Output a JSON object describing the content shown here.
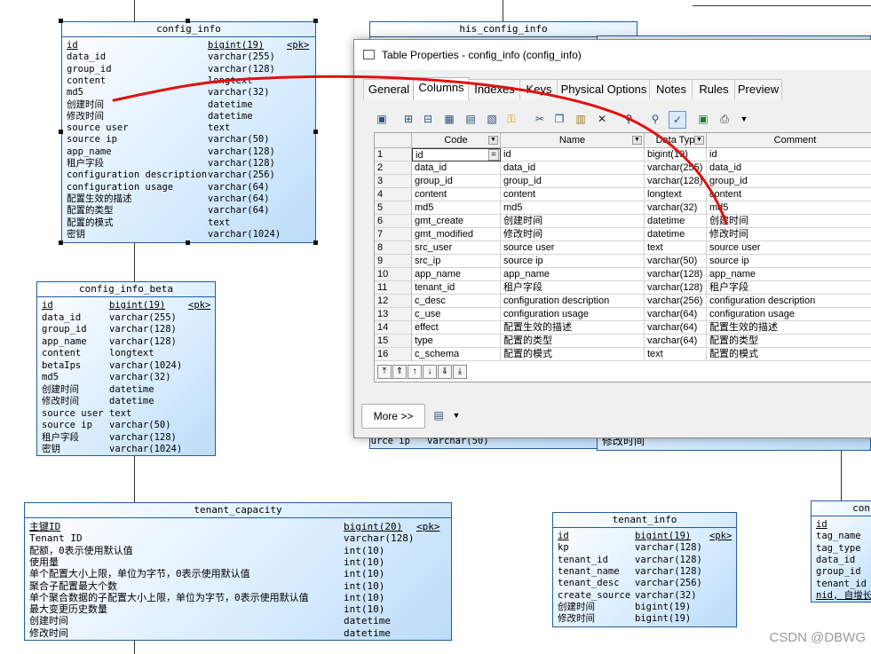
{
  "tables": {
    "config_info": {
      "title": "config_info",
      "pk": "<pk>",
      "rows": [
        [
          "id",
          "bigint(19)"
        ],
        [
          "data_id",
          "varchar(255)"
        ],
        [
          "group_id",
          "varchar(128)"
        ],
        [
          "content",
          "longtext"
        ],
        [
          "md5",
          "varchar(32)"
        ],
        [
          "创建时间",
          "datetime"
        ],
        [
          "修改时间",
          "datetime"
        ],
        [
          "source user",
          "text"
        ],
        [
          "source ip",
          "varchar(50)"
        ],
        [
          "app_name",
          "varchar(128)"
        ],
        [
          "租户字段",
          "varchar(128)"
        ],
        [
          "configuration description",
          "varchar(256)"
        ],
        [
          "configuration usage",
          "varchar(64)"
        ],
        [
          "配置生效的描述",
          "varchar(64)"
        ],
        [
          "配置的类型",
          "varchar(64)"
        ],
        [
          "配置的模式",
          "text"
        ],
        [
          "密钥",
          "varchar(1024)"
        ]
      ]
    },
    "his_config_info": {
      "title": "his_config_info",
      "bottom_row": [
        "source ip",
        "varchar(50)"
      ]
    },
    "right_partial": {
      "title": "",
      "bottom_row": "修改时间"
    },
    "config_info_beta": {
      "title": "config_info_beta",
      "pk": "<pk>",
      "rows": [
        [
          "id",
          "bigint(19)"
        ],
        [
          "data_id",
          "varchar(255)"
        ],
        [
          "group_id",
          "varchar(128)"
        ],
        [
          "app_name",
          "varchar(128)"
        ],
        [
          "content",
          "longtext"
        ],
        [
          "betaIps",
          "varchar(1024)"
        ],
        [
          "md5",
          "varchar(32)"
        ],
        [
          "创建时间",
          "datetime"
        ],
        [
          "修改时间",
          "datetime"
        ],
        [
          "source user",
          "text"
        ],
        [
          "source ip",
          "varchar(50)"
        ],
        [
          "租户字段",
          "varchar(128)"
        ],
        [
          "密钥",
          "varchar(1024)"
        ]
      ]
    },
    "tenant_capacity": {
      "title": "tenant_capacity",
      "pk": "<pk>",
      "rows": [
        [
          "主键ID",
          "bigint(20)"
        ],
        [
          "Tenant ID",
          "varchar(128)"
        ],
        [
          "配额，0表示使用默认值",
          "int(10)"
        ],
        [
          "使用量",
          "int(10)"
        ],
        [
          "单个配置大小上限，单位为字节，0表示使用默认值",
          "int(10)"
        ],
        [
          "聚合子配置最大个数",
          "int(10)"
        ],
        [
          "单个聚合数据的子配置大小上限，单位为字节，0表示使用默认值",
          "int(10)"
        ],
        [
          "最大变更历史数量",
          "int(10)"
        ],
        [
          "创建时间",
          "datetime"
        ],
        [
          "修改时间",
          "datetime"
        ]
      ]
    },
    "tenant_info": {
      "title": "tenant_info",
      "pk": "<pk>",
      "rows": [
        [
          "id",
          "bigint(19)"
        ],
        [
          "kp",
          "varchar(128)"
        ],
        [
          "tenant_id",
          "varchar(128)"
        ],
        [
          "tenant_name",
          "varchar(128)"
        ],
        [
          "tenant_desc",
          "varchar(256)"
        ],
        [
          "create_source",
          "varchar(32)"
        ],
        [
          "创建时间",
          "bigint(19)"
        ],
        [
          "修改时间",
          "bigint(19)"
        ]
      ]
    },
    "partial_right": {
      "title": "con",
      "rows": [
        "id",
        "tag_name",
        "tag_type",
        "data_id",
        "group_id",
        "tenant_id",
        "nid, 自增长"
      ]
    }
  },
  "dialog": {
    "title": "Table Properties - config_info (config_info)",
    "tabs": [
      "General",
      "Columns",
      "Indexes",
      "Keys",
      "Physical Options",
      "Notes",
      "Rules",
      "Preview"
    ],
    "active_tab": "Columns",
    "columns": [
      "Code",
      "Name",
      "Data Typ",
      "Comment"
    ],
    "rows": [
      [
        "1",
        "id",
        "id",
        "bigint(19)",
        "id"
      ],
      [
        "2",
        "data_id",
        "data_id",
        "varchar(255)",
        "data_id"
      ],
      [
        "3",
        "group_id",
        "group_id",
        "varchar(128)",
        "group_id"
      ],
      [
        "4",
        "content",
        "content",
        "longtext",
        "content"
      ],
      [
        "5",
        "md5",
        "md5",
        "varchar(32)",
        "md5"
      ],
      [
        "6",
        "gmt_create",
        "创建时间",
        "datetime",
        "创建时间"
      ],
      [
        "7",
        "gmt_modified",
        "修改时间",
        "datetime",
        "修改时间"
      ],
      [
        "8",
        "src_user",
        "source user",
        "text",
        "source user"
      ],
      [
        "9",
        "src_ip",
        "source ip",
        "varchar(50)",
        "source ip"
      ],
      [
        "10",
        "app_name",
        "app_name",
        "varchar(128)",
        "app_name"
      ],
      [
        "11",
        "tenant_id",
        "租户字段",
        "varchar(128)",
        "租户字段"
      ],
      [
        "12",
        "c_desc",
        "configuration description",
        "varchar(256)",
        "configuration description"
      ],
      [
        "13",
        "c_use",
        "configuration usage",
        "varchar(64)",
        "configuration usage"
      ],
      [
        "14",
        "effect",
        "配置生效的描述",
        "varchar(64)",
        "配置生效的描述"
      ],
      [
        "15",
        "type",
        "配置的类型",
        "varchar(64)",
        "配置的类型"
      ],
      [
        "16",
        "c_schema",
        "配置的模式",
        "text",
        "配置的模式"
      ]
    ],
    "edit_marker": "=",
    "more_button": "More >>"
  },
  "watermark": "CSDN @DBWG",
  "colors": {
    "entity_border": "#1f5f9e",
    "entity_fill": "#cfe6fb",
    "annotation_red": "#e01010"
  }
}
